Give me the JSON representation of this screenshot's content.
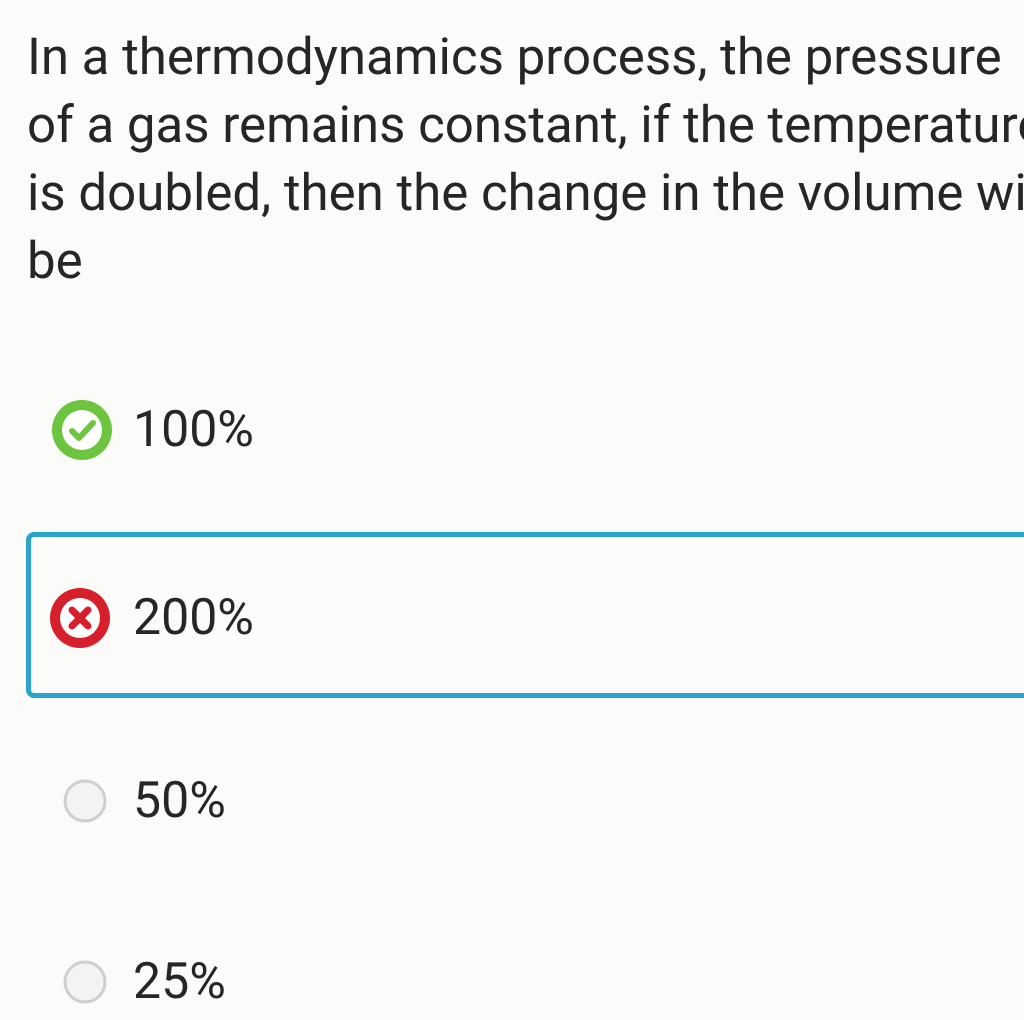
{
  "question": {
    "lines": [
      "In a thermodynamics process, the pressure",
      "of a gas remains constant, if the temperature",
      "is doubled, then the change in the volume will",
      "be"
    ]
  },
  "options": [
    {
      "label": "100%",
      "status": "correct",
      "icon": "check-circle-icon"
    },
    {
      "label": "200%",
      "status": "incorrect-selected",
      "icon": "cross-circle-icon"
    },
    {
      "label": "50%",
      "status": "unselected",
      "icon": "radio-icon"
    },
    {
      "label": "25%",
      "status": "unselected",
      "icon": "radio-icon"
    }
  ],
  "colors": {
    "correct": "#6cc43f",
    "incorrect": "#d8202c",
    "selected_border": "#2aa3cf",
    "text": "#262626",
    "radio_border": "#cfcfcf"
  }
}
